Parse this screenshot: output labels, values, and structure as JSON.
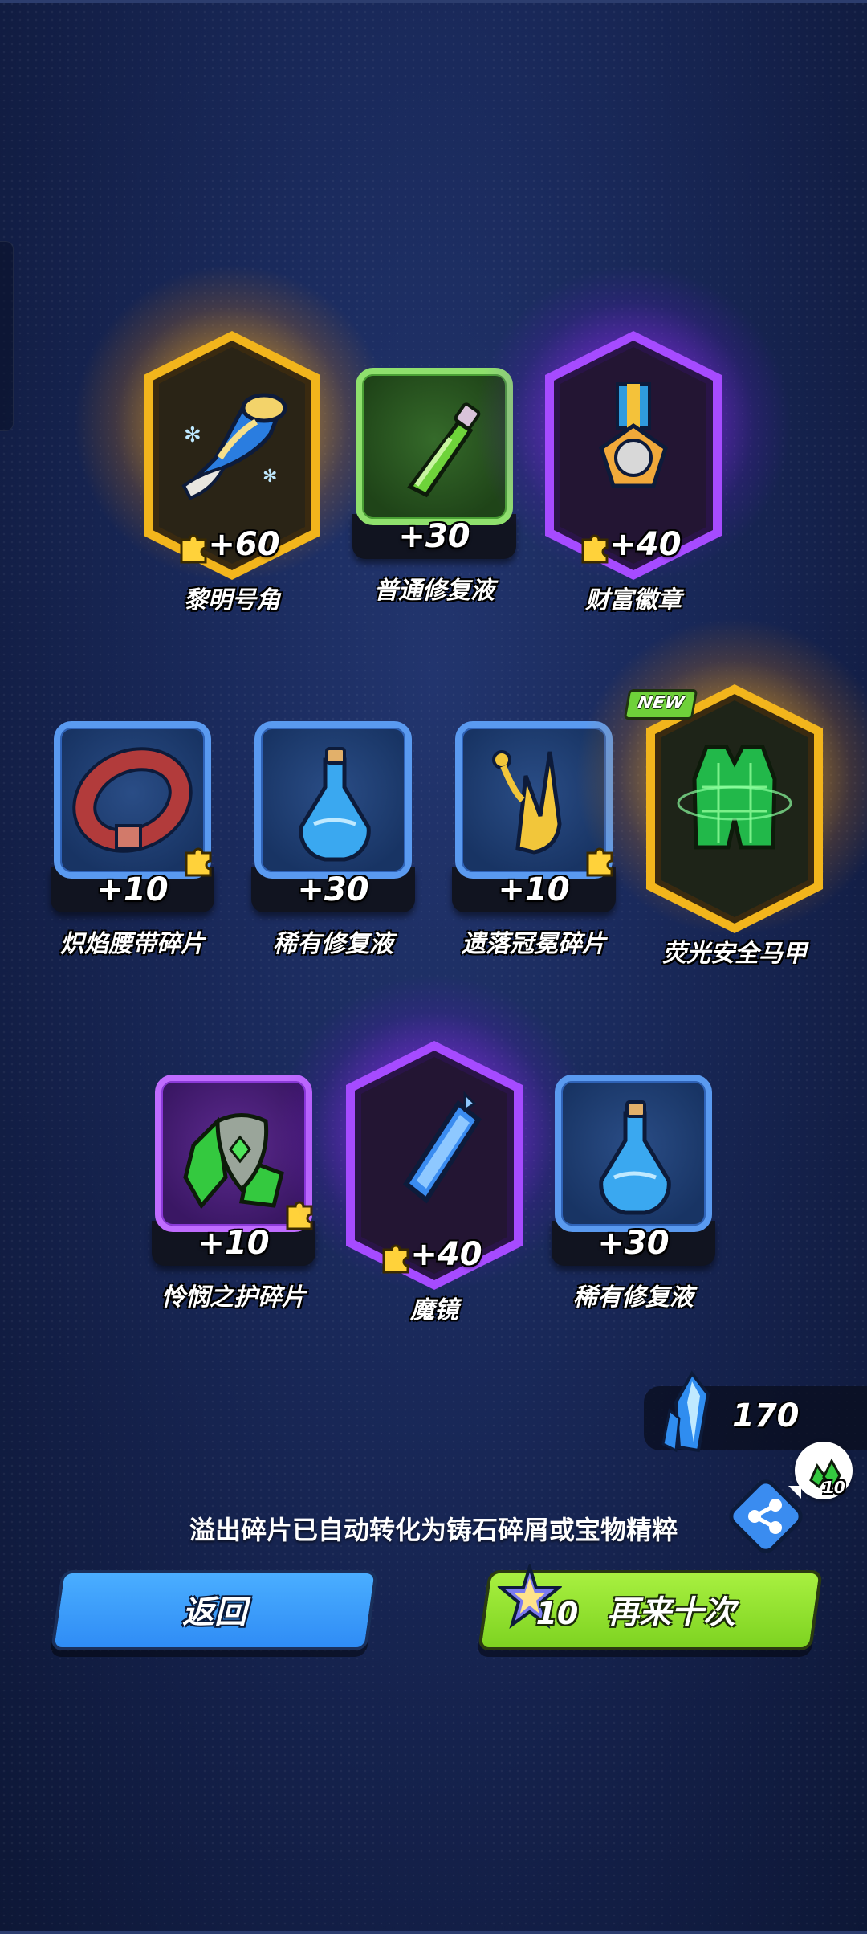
{
  "rewards": [
    {
      "name": "黎明号角",
      "amount": "+60",
      "frame": "gold-hex",
      "shard": true
    },
    {
      "name": "普通修复液",
      "amount": "+30",
      "frame": "green-square",
      "shard": false
    },
    {
      "name": "财富徽章",
      "amount": "+40",
      "frame": "purple-hex",
      "shard": true
    },
    {
      "name": "炽焰腰带碎片",
      "amount": "+10",
      "frame": "blue-square",
      "shard": true
    },
    {
      "name": "稀有修复液",
      "amount": "+30",
      "frame": "blue-square",
      "shard": false
    },
    {
      "name": "遗落冠冕碎片",
      "amount": "+10",
      "frame": "blue-square",
      "shard": true
    },
    {
      "name": "荧光安全马甲",
      "amount": "",
      "frame": "gold-hex",
      "shard": false,
      "badge": "NEW"
    },
    {
      "name": "怜悯之护碎片",
      "amount": "+10",
      "frame": "purple-square",
      "shard": true
    },
    {
      "name": "魔镜",
      "amount": "+40",
      "frame": "purple-hex",
      "shard": true
    },
    {
      "name": "稀有修复液",
      "amount": "+30",
      "frame": "blue-square",
      "shard": false
    }
  ],
  "currency": {
    "icon": "crystal-icon",
    "value": "170"
  },
  "share": {
    "icon": "share-icon",
    "bubble_count": "10"
  },
  "notice": "溢出碎片已自动转化为铸石碎屑或宝物精粹",
  "buttons": {
    "back_label": "返回",
    "again_label": "再来十次",
    "again_cost": "10"
  },
  "colors": {
    "gold": "#ffc83a",
    "purple": "#a64bff",
    "blue_frame": "#5a9af0",
    "green_frame": "#8fe06d",
    "back_button": "#3d9cf7",
    "again_button": "#8de02c"
  }
}
